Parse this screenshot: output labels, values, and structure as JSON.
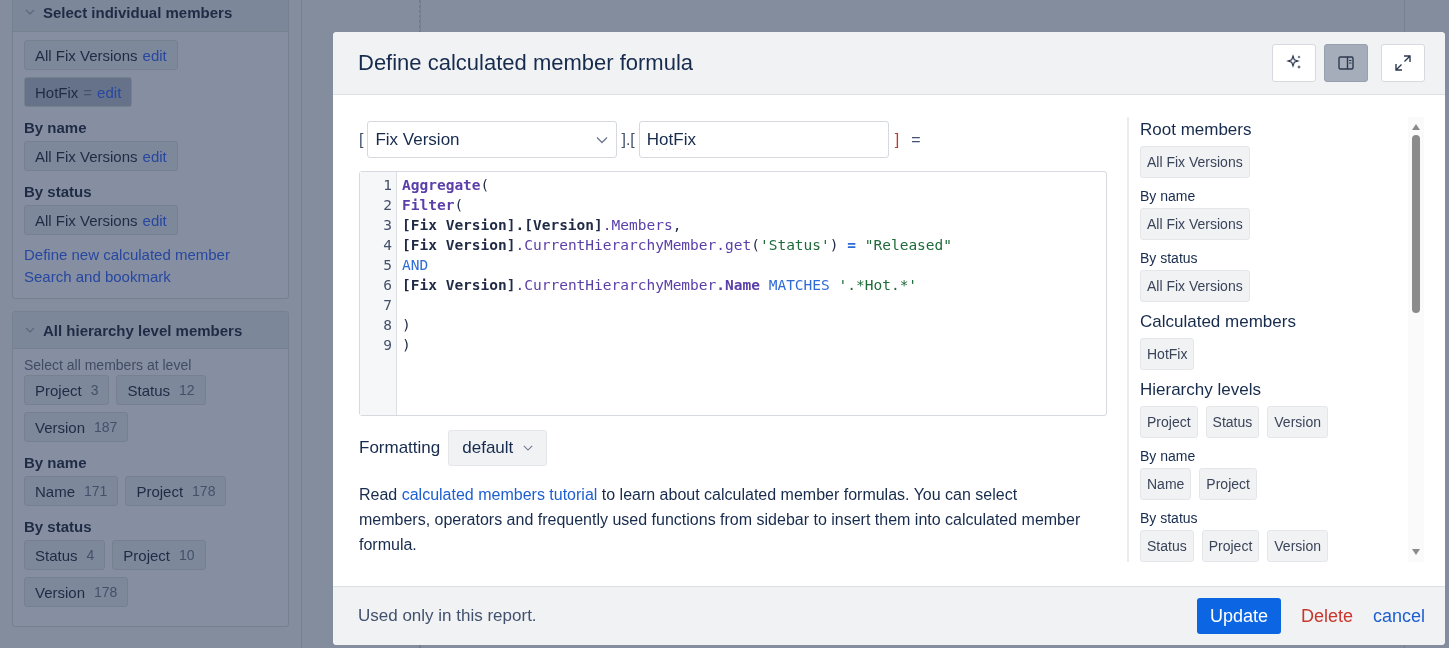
{
  "background": {
    "sections": [
      {
        "title": "Select individual members",
        "expanded": true,
        "blocks": [
          {
            "chips": [
              {
                "label": "All Fix Versions",
                "action": "edit",
                "selected": false
              },
              {
                "label": "HotFix",
                "suffix": "=",
                "action": "edit",
                "selected": true
              }
            ]
          },
          {
            "heading": "By name",
            "chips": [
              {
                "label": "All Fix Versions",
                "action": "edit",
                "selected": false
              }
            ]
          },
          {
            "heading": "By status",
            "chips": [
              {
                "label": "All Fix Versions",
                "action": "edit",
                "selected": false
              }
            ]
          }
        ],
        "links": [
          "Define new calculated member",
          "Search and bookmark"
        ]
      },
      {
        "title": "All hierarchy level members",
        "expanded": true,
        "blocks": [
          {
            "hint": "Select all members at level",
            "chips": [
              {
                "label": "Project",
                "count": "3",
                "selected": false
              },
              {
                "label": "Status",
                "count": "12",
                "selected": false
              },
              {
                "label": "Version",
                "count": "187",
                "selected": false
              }
            ]
          },
          {
            "heading": "By name",
            "chips": [
              {
                "label": "Name",
                "count": "171",
                "selected": false
              },
              {
                "label": "Project",
                "count": "178",
                "selected": false
              }
            ]
          },
          {
            "heading": "By status",
            "chips": [
              {
                "label": "Status",
                "count": "4",
                "selected": false
              },
              {
                "label": "Project",
                "count": "10",
                "selected": false
              },
              {
                "label": "Version",
                "count": "178",
                "selected": false
              }
            ]
          }
        ]
      }
    ]
  },
  "dialog": {
    "title": "Define calculated member formula",
    "toolbar": [
      {
        "kind": "ai",
        "selected": false
      },
      {
        "kind": "sidebar",
        "selected": true
      },
      {
        "kind": "expand",
        "selected": false
      }
    ],
    "brackets": [
      "[",
      "].[",
      "]",
      "="
    ],
    "dimension": "Fix Version",
    "name": "HotFix",
    "code": [
      {
        "number": "1",
        "tokens": [
          {
            "kind": "fn",
            "text": "Aggregate"
          },
          {
            "kind": "plain",
            "text": "("
          }
        ]
      },
      {
        "number": "2",
        "tokens": [
          {
            "kind": "fn",
            "text": "Filter"
          },
          {
            "kind": "plain",
            "text": "("
          }
        ]
      },
      {
        "number": "3",
        "tokens": [
          {
            "kind": "id",
            "text": "[Fix Version].[Version]"
          },
          {
            "kind": "prop",
            "text": ".Members"
          },
          {
            "kind": "plain",
            "text": ","
          }
        ]
      },
      {
        "number": "4",
        "tokens": [
          {
            "kind": "id",
            "text": "[Fix Version]"
          },
          {
            "kind": "prop",
            "text": ".CurrentHierarchyMember"
          },
          {
            "kind": "prop",
            "text": ".get"
          },
          {
            "kind": "plain",
            "text": "("
          },
          {
            "kind": "str",
            "text": "'Status'"
          },
          {
            "kind": "plain",
            "text": ")"
          },
          {
            "kind": "opb",
            "text": " = "
          },
          {
            "kind": "str",
            "text": "\"Released\""
          }
        ]
      },
      {
        "number": "5",
        "tokens": [
          {
            "kind": "op",
            "text": "AND"
          }
        ]
      },
      {
        "number": "6",
        "tokens": [
          {
            "kind": "id",
            "text": "[Fix Version]"
          },
          {
            "kind": "prop",
            "text": ".CurrentHierarchyMember"
          },
          {
            "kind": "propb",
            "text": ".Name"
          },
          {
            "kind": "op",
            "text": " MATCHES "
          },
          {
            "kind": "str",
            "text": "'.*Hot.*'"
          }
        ]
      },
      {
        "number": "7"
      },
      {
        "number": "8",
        "tokens": [
          {
            "kind": "plain",
            "text": ")"
          }
        ]
      },
      {
        "number": "9",
        "tokens": [
          {
            "kind": "plain",
            "text": ")"
          }
        ]
      }
    ],
    "formatting": {
      "label": "Formatting",
      "value": "default"
    },
    "help": {
      "before": "Read ",
      "link": "calculated members tutorial",
      "after": " to learn about calculated member formulas. You can select members, operators and frequently used functions from sidebar to insert them into calculated member formula."
    },
    "sidebar": {
      "sections": [
        {
          "title": "Root members",
          "kind": "major",
          "chips": [
            "All Fix Versions"
          ]
        },
        {
          "title": "By name",
          "kind": "minor",
          "chips": [
            "All Fix Versions"
          ]
        },
        {
          "title": "By status",
          "kind": "minor",
          "chips": [
            "All Fix Versions"
          ]
        },
        {
          "title": "Calculated members",
          "kind": "major",
          "chips": [
            "HotFix"
          ]
        },
        {
          "title": "Hierarchy levels",
          "kind": "major",
          "chips": [
            "Project",
            "Status",
            "Version"
          ]
        },
        {
          "title": "By name",
          "kind": "minor",
          "chips": [
            "Name",
            "Project"
          ]
        },
        {
          "title": "By status",
          "kind": "minor",
          "chips": [
            "Status",
            "Project",
            "Version"
          ]
        }
      ]
    },
    "footer": {
      "note": "Used only in this report.",
      "buttons": [
        {
          "label": "Update",
          "kind": "primary"
        },
        {
          "label": "Delete",
          "kind": "danger"
        },
        {
          "label": "cancel",
          "kind": "link"
        }
      ]
    }
  }
}
